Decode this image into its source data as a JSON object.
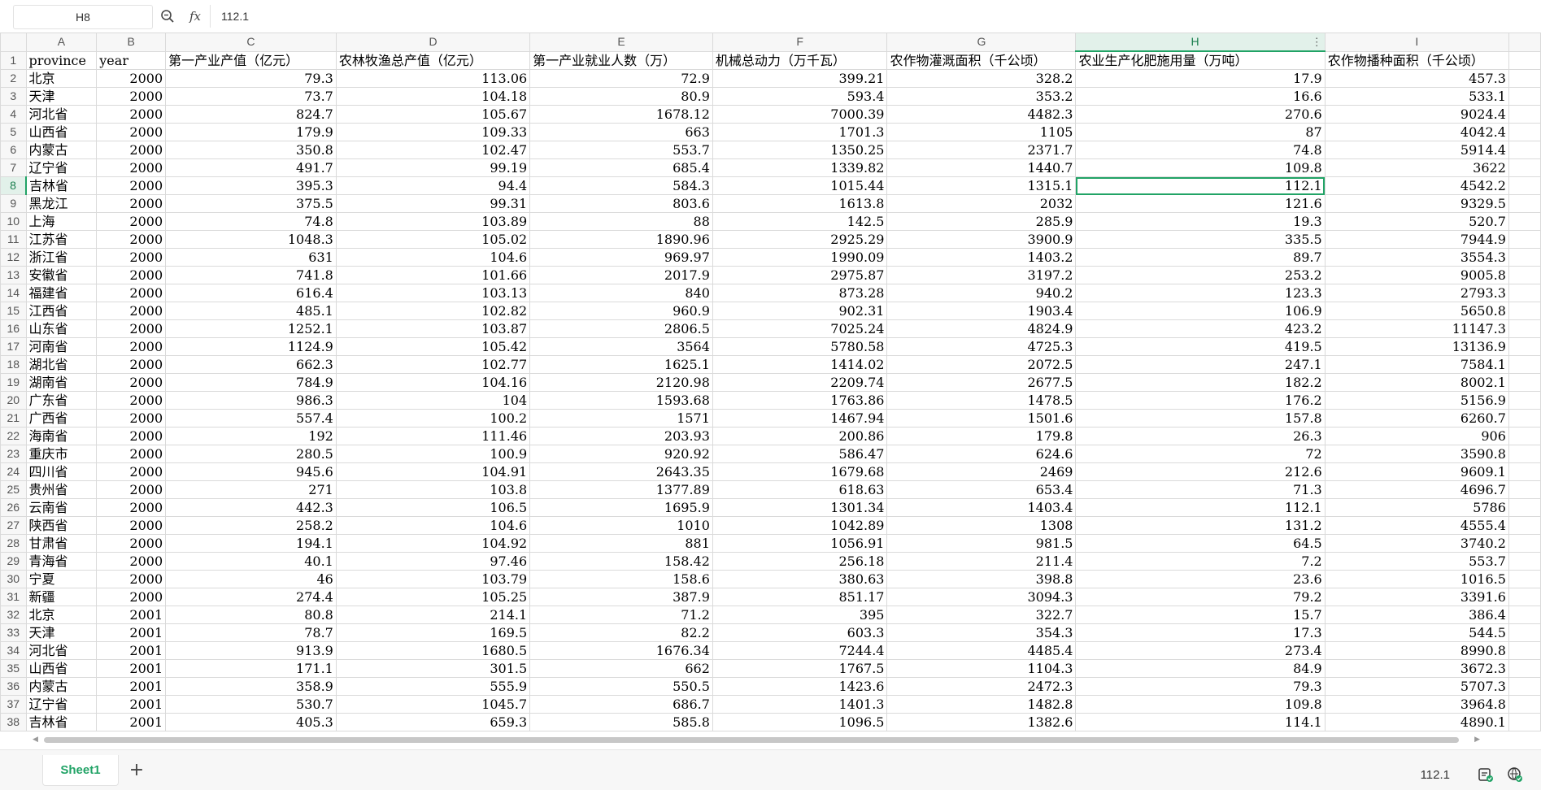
{
  "formula_bar": {
    "cell_ref": "H8",
    "fx_label": "fx",
    "value": "112.1"
  },
  "columns": [
    "A",
    "B",
    "C",
    "D",
    "E",
    "F",
    "G",
    "H",
    "I"
  ],
  "selected_column": "H",
  "selected_row": 8,
  "header_row": [
    "province",
    "year",
    "第一产业产值（亿元）",
    "农林牧渔总产值（亿元）",
    "第一产业就业人数（万）",
    "机械总动力（万千瓦）",
    "农作物灌溉面积（千公顷）",
    "农业生产化肥施用量（万吨）",
    "农作物播种面积（千公顷）"
  ],
  "rows": [
    [
      "北京",
      "2000",
      "79.3",
      "113.06",
      "72.9",
      "399.21",
      "328.2",
      "17.9",
      "457.3"
    ],
    [
      "天津",
      "2000",
      "73.7",
      "104.18",
      "80.9",
      "593.4",
      "353.2",
      "16.6",
      "533.1"
    ],
    [
      "河北省",
      "2000",
      "824.7",
      "105.67",
      "1678.12",
      "7000.39",
      "4482.3",
      "270.6",
      "9024.4"
    ],
    [
      "山西省",
      "2000",
      "179.9",
      "109.33",
      "663",
      "1701.3",
      "1105",
      "87",
      "4042.4"
    ],
    [
      "内蒙古",
      "2000",
      "350.8",
      "102.47",
      "553.7",
      "1350.25",
      "2371.7",
      "74.8",
      "5914.4"
    ],
    [
      "辽宁省",
      "2000",
      "491.7",
      "99.19",
      "685.4",
      "1339.82",
      "1440.7",
      "109.8",
      "3622"
    ],
    [
      "吉林省",
      "2000",
      "395.3",
      "94.4",
      "584.3",
      "1015.44",
      "1315.1",
      "112.1",
      "4542.2"
    ],
    [
      "黑龙江",
      "2000",
      "375.5",
      "99.31",
      "803.6",
      "1613.8",
      "2032",
      "121.6",
      "9329.5"
    ],
    [
      "上海",
      "2000",
      "74.8",
      "103.89",
      "88",
      "142.5",
      "285.9",
      "19.3",
      "520.7"
    ],
    [
      "江苏省",
      "2000",
      "1048.3",
      "105.02",
      "1890.96",
      "2925.29",
      "3900.9",
      "335.5",
      "7944.9"
    ],
    [
      "浙江省",
      "2000",
      "631",
      "104.6",
      "969.97",
      "1990.09",
      "1403.2",
      "89.7",
      "3554.3"
    ],
    [
      "安徽省",
      "2000",
      "741.8",
      "101.66",
      "2017.9",
      "2975.87",
      "3197.2",
      "253.2",
      "9005.8"
    ],
    [
      "福建省",
      "2000",
      "616.4",
      "103.13",
      "840",
      "873.28",
      "940.2",
      "123.3",
      "2793.3"
    ],
    [
      "江西省",
      "2000",
      "485.1",
      "102.82",
      "960.9",
      "902.31",
      "1903.4",
      "106.9",
      "5650.8"
    ],
    [
      "山东省",
      "2000",
      "1252.1",
      "103.87",
      "2806.5",
      "7025.24",
      "4824.9",
      "423.2",
      "11147.3"
    ],
    [
      "河南省",
      "2000",
      "1124.9",
      "105.42",
      "3564",
      "5780.58",
      "4725.3",
      "419.5",
      "13136.9"
    ],
    [
      "湖北省",
      "2000",
      "662.3",
      "102.77",
      "1625.1",
      "1414.02",
      "2072.5",
      "247.1",
      "7584.1"
    ],
    [
      "湖南省",
      "2000",
      "784.9",
      "104.16",
      "2120.98",
      "2209.74",
      "2677.5",
      "182.2",
      "8002.1"
    ],
    [
      "广东省",
      "2000",
      "986.3",
      "104",
      "1593.68",
      "1763.86",
      "1478.5",
      "176.2",
      "5156.9"
    ],
    [
      "广西省",
      "2000",
      "557.4",
      "100.2",
      "1571",
      "1467.94",
      "1501.6",
      "157.8",
      "6260.7"
    ],
    [
      "海南省",
      "2000",
      "192",
      "111.46",
      "203.93",
      "200.86",
      "179.8",
      "26.3",
      "906"
    ],
    [
      "重庆市",
      "2000",
      "280.5",
      "100.9",
      "920.92",
      "586.47",
      "624.6",
      "72",
      "3590.8"
    ],
    [
      "四川省",
      "2000",
      "945.6",
      "104.91",
      "2643.35",
      "1679.68",
      "2469",
      "212.6",
      "9609.1"
    ],
    [
      "贵州省",
      "2000",
      "271",
      "103.8",
      "1377.89",
      "618.63",
      "653.4",
      "71.3",
      "4696.7"
    ],
    [
      "云南省",
      "2000",
      "442.3",
      "106.5",
      "1695.9",
      "1301.34",
      "1403.4",
      "112.1",
      "5786"
    ],
    [
      "陕西省",
      "2000",
      "258.2",
      "104.6",
      "1010",
      "1042.89",
      "1308",
      "131.2",
      "4555.4"
    ],
    [
      "甘肃省",
      "2000",
      "194.1",
      "104.92",
      "881",
      "1056.91",
      "981.5",
      "64.5",
      "3740.2"
    ],
    [
      "青海省",
      "2000",
      "40.1",
      "97.46",
      "158.42",
      "256.18",
      "211.4",
      "7.2",
      "553.7"
    ],
    [
      "宁夏",
      "2000",
      "46",
      "103.79",
      "158.6",
      "380.63",
      "398.8",
      "23.6",
      "1016.5"
    ],
    [
      "新疆",
      "2000",
      "274.4",
      "105.25",
      "387.9",
      "851.17",
      "3094.3",
      "79.2",
      "3391.6"
    ],
    [
      "北京",
      "2001",
      "80.8",
      "214.1",
      "71.2",
      "395",
      "322.7",
      "15.7",
      "386.4"
    ],
    [
      "天津",
      "2001",
      "78.7",
      "169.5",
      "82.2",
      "603.3",
      "354.3",
      "17.3",
      "544.5"
    ],
    [
      "河北省",
      "2001",
      "913.9",
      "1680.5",
      "1676.34",
      "7244.4",
      "4485.4",
      "273.4",
      "8990.8"
    ],
    [
      "山西省",
      "2001",
      "171.1",
      "301.5",
      "662",
      "1767.5",
      "1104.3",
      "84.9",
      "3672.3"
    ],
    [
      "内蒙古",
      "2001",
      "358.9",
      "555.9",
      "550.5",
      "1423.6",
      "2472.3",
      "79.3",
      "5707.3"
    ],
    [
      "辽宁省",
      "2001",
      "530.7",
      "1045.7",
      "686.7",
      "1401.3",
      "1482.8",
      "109.8",
      "3964.8"
    ],
    [
      "吉林省",
      "2001",
      "405.3",
      "659.3",
      "585.8",
      "1096.5",
      "1382.6",
      "114.1",
      "4890.1"
    ]
  ],
  "sheet_tab": "Sheet1",
  "add_sheet_label": "+",
  "status": {
    "selection_value": "112.1"
  }
}
